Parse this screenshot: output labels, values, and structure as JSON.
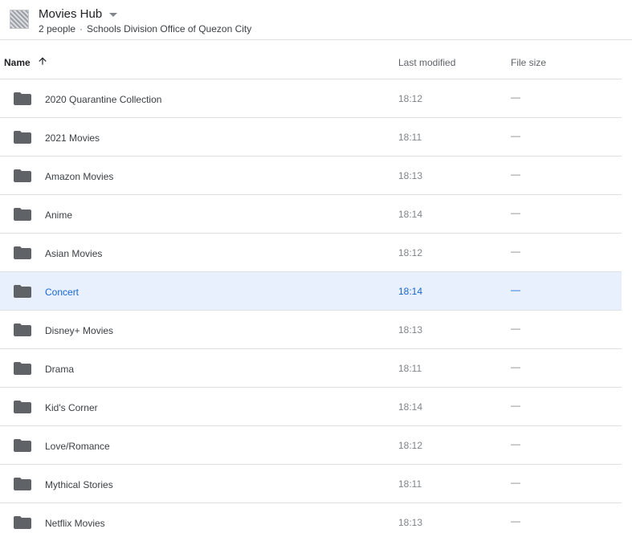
{
  "header": {
    "title": "Movies Hub",
    "people": "2 people",
    "separator": "·",
    "organization": "Schools Division Office of Quezon City"
  },
  "columns": {
    "name": "Name",
    "last_modified": "Last modified",
    "file_size": "File size"
  },
  "sort": {
    "column": "name",
    "direction": "ascending",
    "icon": "arrow-up-icon"
  },
  "rows": [
    {
      "name": "2020 Quarantine Collection",
      "modified": "18:12",
      "size": "—",
      "icon": "folder-icon"
    },
    {
      "name": "2021 Movies",
      "modified": "18:11",
      "size": "—",
      "icon": "folder-icon"
    },
    {
      "name": "Amazon Movies",
      "modified": "18:13",
      "size": "—",
      "icon": "folder-icon"
    },
    {
      "name": "Anime",
      "modified": "18:14",
      "size": "—",
      "icon": "folder-icon"
    },
    {
      "name": "Asian Movies",
      "modified": "18:12",
      "size": "—",
      "icon": "folder-icon"
    },
    {
      "name": "Concert",
      "modified": "18:14",
      "size": "—",
      "icon": "folder-icon",
      "selected": true
    },
    {
      "name": "Disney+ Movies",
      "modified": "18:13",
      "size": "—",
      "icon": "folder-icon"
    },
    {
      "name": "Drama",
      "modified": "18:11",
      "size": "—",
      "icon": "folder-icon"
    },
    {
      "name": "Kid's Corner",
      "modified": "18:14",
      "size": "—",
      "icon": "folder-icon"
    },
    {
      "name": "Love/Romance",
      "modified": "18:12",
      "size": "—",
      "icon": "folder-icon"
    },
    {
      "name": "Mythical Stories",
      "modified": "18:11",
      "size": "—",
      "icon": "folder-icon"
    },
    {
      "name": "Netflix Movies",
      "modified": "18:13",
      "size": "—",
      "icon": "folder-icon"
    }
  ],
  "colors": {
    "folder": "#5f6368",
    "selected_background": "#e8f0fe",
    "selected_text": "#1967d2",
    "divider": "#e0e0e0"
  }
}
